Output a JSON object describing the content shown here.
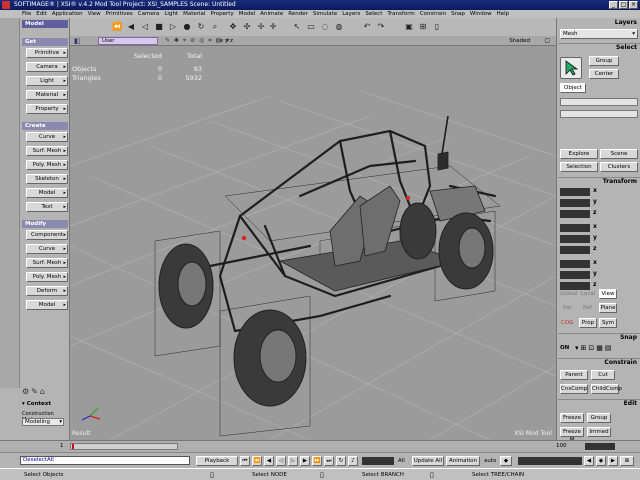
{
  "window": {
    "title": "SOFTIMAGE® | XSI® v.4.2 Mod Tool Project: XSI_SAMPLES   Scene: Untitled",
    "buttons": [
      "_",
      "□",
      "×"
    ]
  },
  "menu": [
    "File",
    "Edit",
    "Application",
    "View",
    "Primitives",
    "Camera",
    "Light",
    "Material",
    "Property",
    "Model",
    "Animate",
    "Render",
    "Simulate",
    "Layers",
    "Select",
    "Transform",
    "Constrain",
    "Snap",
    "Window",
    "Help"
  ],
  "viewport": {
    "camera_menu": "User",
    "right_label": "Shaded",
    "axis_text": "x y z",
    "stats": {
      "headers": [
        "",
        "Selected",
        "Total"
      ],
      "rows": [
        [
          "Objects",
          "0",
          "83"
        ],
        [
          "Triangles",
          "0",
          "5932"
        ]
      ]
    },
    "corner_left": "Result",
    "corner_right": "XSI Mod Tool"
  },
  "left_panel": {
    "header": "Model",
    "get": {
      "title": "Get",
      "buttons": [
        "Primitive",
        "Camera",
        "Light",
        "Material",
        "Property"
      ]
    },
    "create": {
      "title": "Create",
      "buttons": [
        "Curve",
        "Surf. Mesh",
        "Poly. Mesh",
        "Skeleton",
        "Model",
        "Text"
      ]
    },
    "modify": {
      "title": "Modify",
      "buttons": [
        "Component",
        "Curve",
        "Surf. Mesh",
        "Poly. Mesh",
        "Deform",
        "Model"
      ]
    },
    "context": {
      "title": "Context",
      "mode_label": "Construction Mode",
      "mode_value": "Modeling"
    }
  },
  "right_panel": {
    "layers": {
      "title": "Layers",
      "value": "Mesh"
    },
    "select": {
      "title": "Select",
      "buttons": [
        "Group",
        "Center",
        "Object",
        "Explore",
        "Scene",
        "Selection",
        "Clusters"
      ]
    },
    "transform": {
      "title": "Transform",
      "axes": [
        "x",
        "y",
        "z"
      ],
      "ref_modes": [
        "Global",
        "Local",
        "View",
        "Par",
        "Ref",
        "Plane"
      ],
      "cog": "COG",
      "buttons": [
        "Prop",
        "Sym"
      ]
    },
    "snap": {
      "title": "Snap",
      "on_label": "ON"
    },
    "constrain": {
      "title": "Constrain",
      "buttons": [
        "Parent",
        "Cut",
        "CnsComp",
        "ChildComp"
      ]
    },
    "edit": {
      "title": "Edit",
      "buttons": [
        "Freeze",
        "Group",
        "Freeze M",
        "Immed"
      ]
    }
  },
  "timeline": {
    "start": "1",
    "end": "100"
  },
  "playback": {
    "command_text": "DeselectAll",
    "playback_label": "Playback",
    "all_label": "All",
    "update_label": "Update All",
    "animation_label": "Animation",
    "auto_label": "auto"
  },
  "status": {
    "left": "Select Objects",
    "mid1": "Select NODE",
    "mid2": "Select BRANCH",
    "mid3": "Select TREE/CHAIN"
  }
}
